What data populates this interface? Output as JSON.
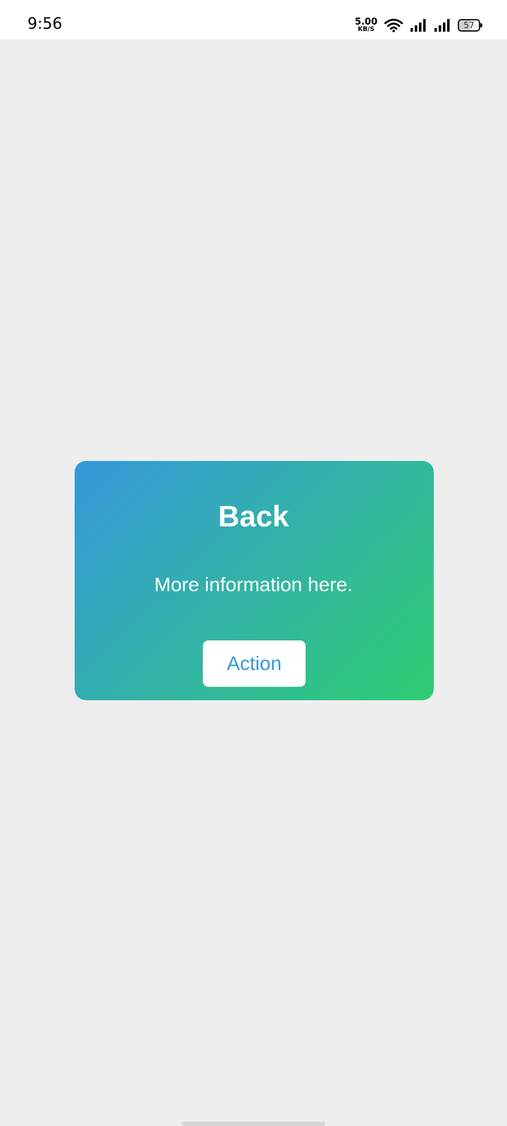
{
  "status_bar": {
    "time": "9:56",
    "net_speed_value": "5.00",
    "net_speed_unit": "KB/S",
    "battery_level": "57",
    "icons": [
      "wifi-icon",
      "signal-icon",
      "signal-icon",
      "battery-icon"
    ]
  },
  "card": {
    "title": "Back",
    "text": "More information here.",
    "action_label": "Action",
    "gradient_start": "#3498db",
    "gradient_end": "#2ecc71"
  },
  "colors": {
    "background": "#eeeeee",
    "button_text": "#3498db"
  }
}
